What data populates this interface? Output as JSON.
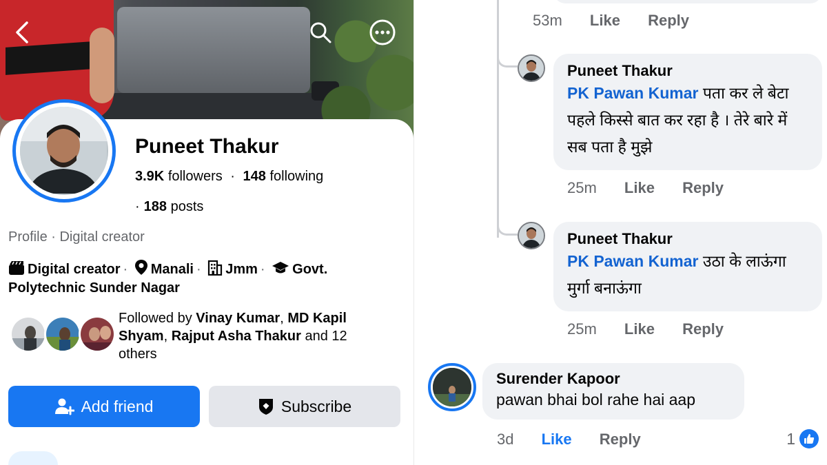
{
  "profile": {
    "name": "Puneet Thakur",
    "followers_count": "3.9K",
    "followers_label": "followers",
    "separator": "·",
    "following_count": "148",
    "following_label": "following",
    "posts_count": "188",
    "posts_label": "posts",
    "profile_type": "Profile · Digital creator",
    "details": {
      "category": "Digital creator",
      "location": "Manali",
      "work": "Jmm",
      "education": "Govt. Polytechnic Sunder Nagar"
    },
    "followed_by": {
      "prefix": "Followed by",
      "names": [
        "Vinay Kumar",
        "MD Kapil Shyam",
        "Rajput Asha Thakur"
      ],
      "suffix": "and 12 others"
    },
    "buttons": {
      "add_friend": "Add friend",
      "subscribe": "Subscribe"
    }
  },
  "comments": {
    "previous": {
      "time": "53m",
      "like": "Like",
      "reply": "Reply"
    },
    "items": [
      {
        "author": "Puneet Thakur",
        "mention": "PK Pawan Kumar",
        "text": "पता कर ले बेटा पहले किस्से बात कर रहा है । तेरे बारे में सब पता है मुझे",
        "time": "25m",
        "like": "Like",
        "reply": "Reply"
      },
      {
        "author": "Puneet Thakur",
        "mention": "PK Pawan Kumar",
        "text": "उठा के लाऊंगा मुर्गा बनाऊंगा",
        "time": "25m",
        "like": "Like",
        "reply": "Reply"
      },
      {
        "author": "Surender Kapoor",
        "text": "pawan bhai bol rahe hai aap",
        "time": "3d",
        "like": "Like",
        "reply": "Reply",
        "reaction_count": "1"
      }
    ]
  },
  "icons": [
    "back-arrow-icon",
    "search-icon",
    "more-options-icon",
    "clapperboard-icon",
    "location-pin-icon",
    "building-icon",
    "graduation-cap-icon",
    "add-person-icon",
    "shield-icon",
    "like-thumb-icon"
  ],
  "colors": {
    "brand": "#1877f2",
    "bubble": "#f0f2f5",
    "muted": "#65676b",
    "mention": "#1363d1"
  }
}
